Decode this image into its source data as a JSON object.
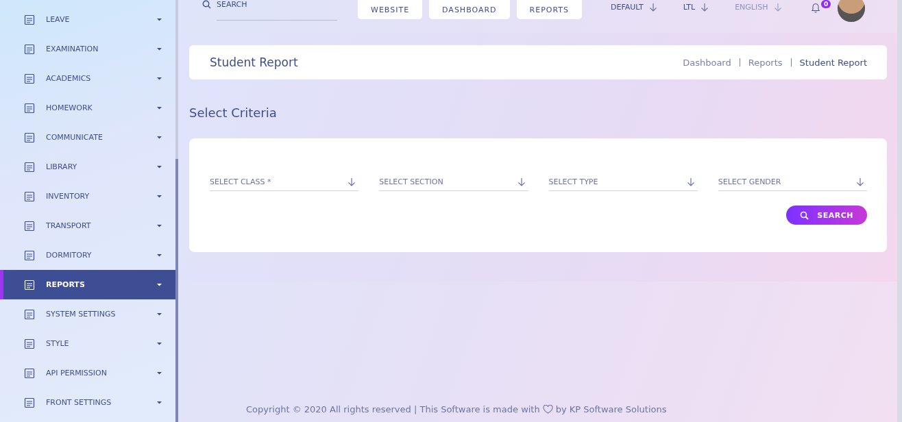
{
  "sidebar": {
    "items": [
      {
        "label": "LEAVE",
        "selected": false
      },
      {
        "label": "EXAMINATION",
        "selected": false
      },
      {
        "label": "ACADEMICS",
        "selected": false
      },
      {
        "label": "HOMEWORK",
        "selected": false
      },
      {
        "label": "COMMUNICATE",
        "selected": false
      },
      {
        "label": "LIBRARY",
        "selected": false
      },
      {
        "label": "INVENTORY",
        "selected": false
      },
      {
        "label": "TRANSPORT",
        "selected": false
      },
      {
        "label": "DORMITORY",
        "selected": false
      },
      {
        "label": "REPORTS",
        "selected": true
      },
      {
        "label": "SYSTEM SETTINGS",
        "selected": false
      },
      {
        "label": "STYLE",
        "selected": false
      },
      {
        "label": "API PERMISSION",
        "selected": false
      },
      {
        "label": "FRONT SETTINGS",
        "selected": false
      }
    ]
  },
  "topbar": {
    "search": {
      "placeholder": "SEARCH"
    },
    "nav_buttons": [
      "WEBSITE",
      "DASHBOARD",
      "REPORTS"
    ],
    "dropdowns": [
      {
        "label": "DEFAULT",
        "disabled": false
      },
      {
        "label": "LTL",
        "disabled": false
      },
      {
        "label": "ENGLISH",
        "disabled": true
      }
    ],
    "notification_count": "0"
  },
  "page_header": {
    "title": "Student Report",
    "breadcrumbs": [
      "Dashboard",
      "Reports",
      "Student Report"
    ]
  },
  "criteria": {
    "heading": "Select Criteria",
    "fields": [
      {
        "placeholder": "SELECT CLASS *"
      },
      {
        "placeholder": "SELECT SECTION"
      },
      {
        "placeholder": "SELECT TYPE"
      },
      {
        "placeholder": "SELECT GENDER"
      }
    ],
    "button": "SEARCH"
  },
  "footer": {
    "text": "Copyright © 2020 All rights reserved | This Software is made with",
    "suffix": "by KP Software Solutions"
  }
}
